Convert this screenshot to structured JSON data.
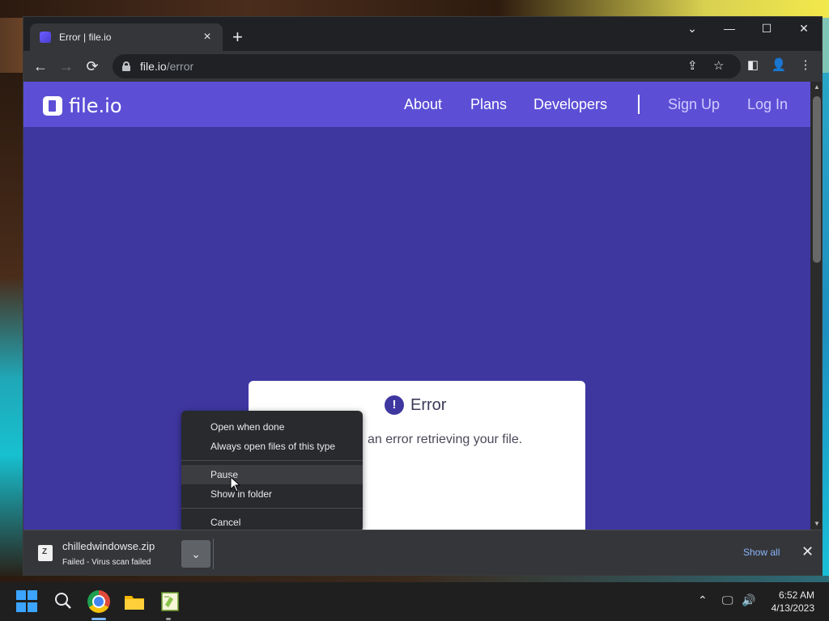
{
  "browser": {
    "tab_title": "Error | file.io",
    "new_tab_label": "+",
    "url_host": "file.io",
    "url_path": "/error",
    "window_controls": {
      "dropdown": "⌄",
      "minimize": "—",
      "maximize": "☐",
      "close": "✕"
    },
    "nav_icons": {
      "back": "←",
      "forward": "→",
      "reload": "⟳"
    },
    "toolbar_icons": {
      "share": "⇪",
      "bookmark": "☆",
      "sidepanel": "◧",
      "profile": "👤",
      "menu": "⋮"
    }
  },
  "site": {
    "logo_text": "file.io",
    "nav_links": [
      "About",
      "Plans",
      "Developers"
    ],
    "sign_up": "Sign Up",
    "log_in": "Log In",
    "brand_color": "#5c4fd6",
    "background_color": "#3f37a0"
  },
  "error_card": {
    "icon": "!",
    "title": "Error",
    "message": "an error retrieving your file."
  },
  "context_menu": {
    "items_top": [
      "Open when done",
      "Always open files of this type"
    ],
    "items_mid": [
      "Pause",
      "Show in folder"
    ],
    "items_bottom": [
      "Cancel"
    ],
    "hovered": "Pause"
  },
  "download_shelf": {
    "file_name": "chilledwindowse.zip",
    "status": "Failed - Virus scan failed",
    "chevron": "⌄",
    "show_all": "Show all",
    "close": "✕"
  },
  "taskbar": {
    "tray_icons": {
      "chevron_up": "⌃",
      "network": "🖵",
      "volume": "🔊"
    },
    "time": "6:52 AM",
    "date": "4/13/2023"
  }
}
